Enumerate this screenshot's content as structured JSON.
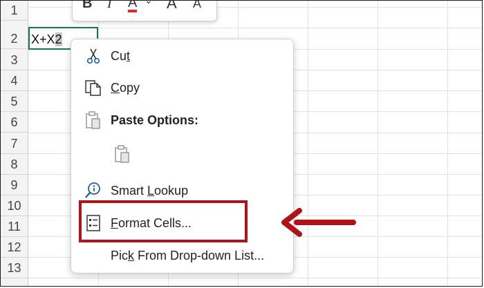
{
  "sheet": {
    "rows": [
      "1",
      "2",
      "3",
      "4",
      "5",
      "6",
      "7",
      "8",
      "9",
      "10",
      "11",
      "12",
      "13"
    ],
    "active_cell_value": "X+X2"
  },
  "mini_toolbar": {
    "bold": "B",
    "italic": "I",
    "font_color": "A",
    "font_color_accent": "#d32f2f",
    "grow_font": "A",
    "shrink_font": "A"
  },
  "context_menu": {
    "items": [
      {
        "pre": "Cu",
        "key": "t",
        "post": "",
        "icon": "scissors-icon"
      },
      {
        "pre": "",
        "key": "C",
        "post": "opy",
        "icon": "copy-icon"
      },
      {
        "label": "Paste Options:",
        "icon": "clipboard-icon"
      },
      {
        "label": "",
        "icon": "paste-icon"
      },
      {
        "pre": "Smart ",
        "key": "L",
        "post": "ookup",
        "icon": "smart-lookup-icon"
      },
      {
        "pre": "",
        "key": "F",
        "post": "ormat Cells...",
        "icon": "format-cells-icon"
      },
      {
        "pre": "Pic",
        "key": "k",
        "post": " From Drop-down List...",
        "icon": ""
      }
    ]
  },
  "annotation": {
    "box_color": "#b01218",
    "arrow_color": "#b01218"
  }
}
